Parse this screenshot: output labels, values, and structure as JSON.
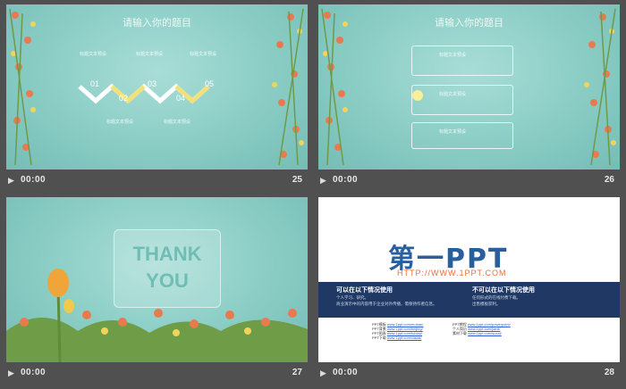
{
  "slides": [
    {
      "number": "25",
      "time": "00:00",
      "title": "请输入你的题目",
      "labels": [
        "标题文本预设",
        "标题文本预设",
        "标题文本预设",
        "标题文本预设",
        "标题文本预设"
      ],
      "steps": [
        "01",
        "02",
        "03",
        "04",
        "05"
      ]
    },
    {
      "number": "26",
      "time": "00:00",
      "title": "请输入你的题目",
      "boxes": [
        "标题文本预设",
        "标题文本预设",
        "标题文本预设"
      ]
    },
    {
      "number": "27",
      "time": "00:00",
      "thank_line1": "THANK",
      "thank_line2": "YOU"
    },
    {
      "number": "28",
      "time": "00:00",
      "logo": "第一PPT",
      "url": "HTTP://WWW.1PPT.COM",
      "left_heading": "可以在以下情况使用",
      "right_heading": "不可以在以下情况使用",
      "left_items": [
        "个人学习、研究。",
        "商业演示中的内容用于企业对外传播，需保持作者信息。"
      ],
      "right_items": [
        "任何形式的在线付费下载。",
        "出售模板获利。"
      ],
      "link_labels": [
        "PPT模板",
        "PPT背景",
        "PPT图表",
        "PPT下载",
        "PPT教程",
        "个人简历",
        "素材下载"
      ],
      "link_urls": [
        "www.1ppt.com/moban/",
        "www.1ppt.com/beijing/",
        "www.1ppt.com/tubiao/",
        "www.1ppt.com/xiazai/",
        "www.1ppt.com/powerpoint/",
        "www.1ppt.com/jianli/",
        "www.1ppt.com/sucai/"
      ]
    }
  ],
  "play_icon": "play-icon",
  "colors": {
    "teal": "#8fd0c8",
    "navy": "#1f3864",
    "logo_blue": "#2a5f9e",
    "url_orange": "#e8703a"
  }
}
